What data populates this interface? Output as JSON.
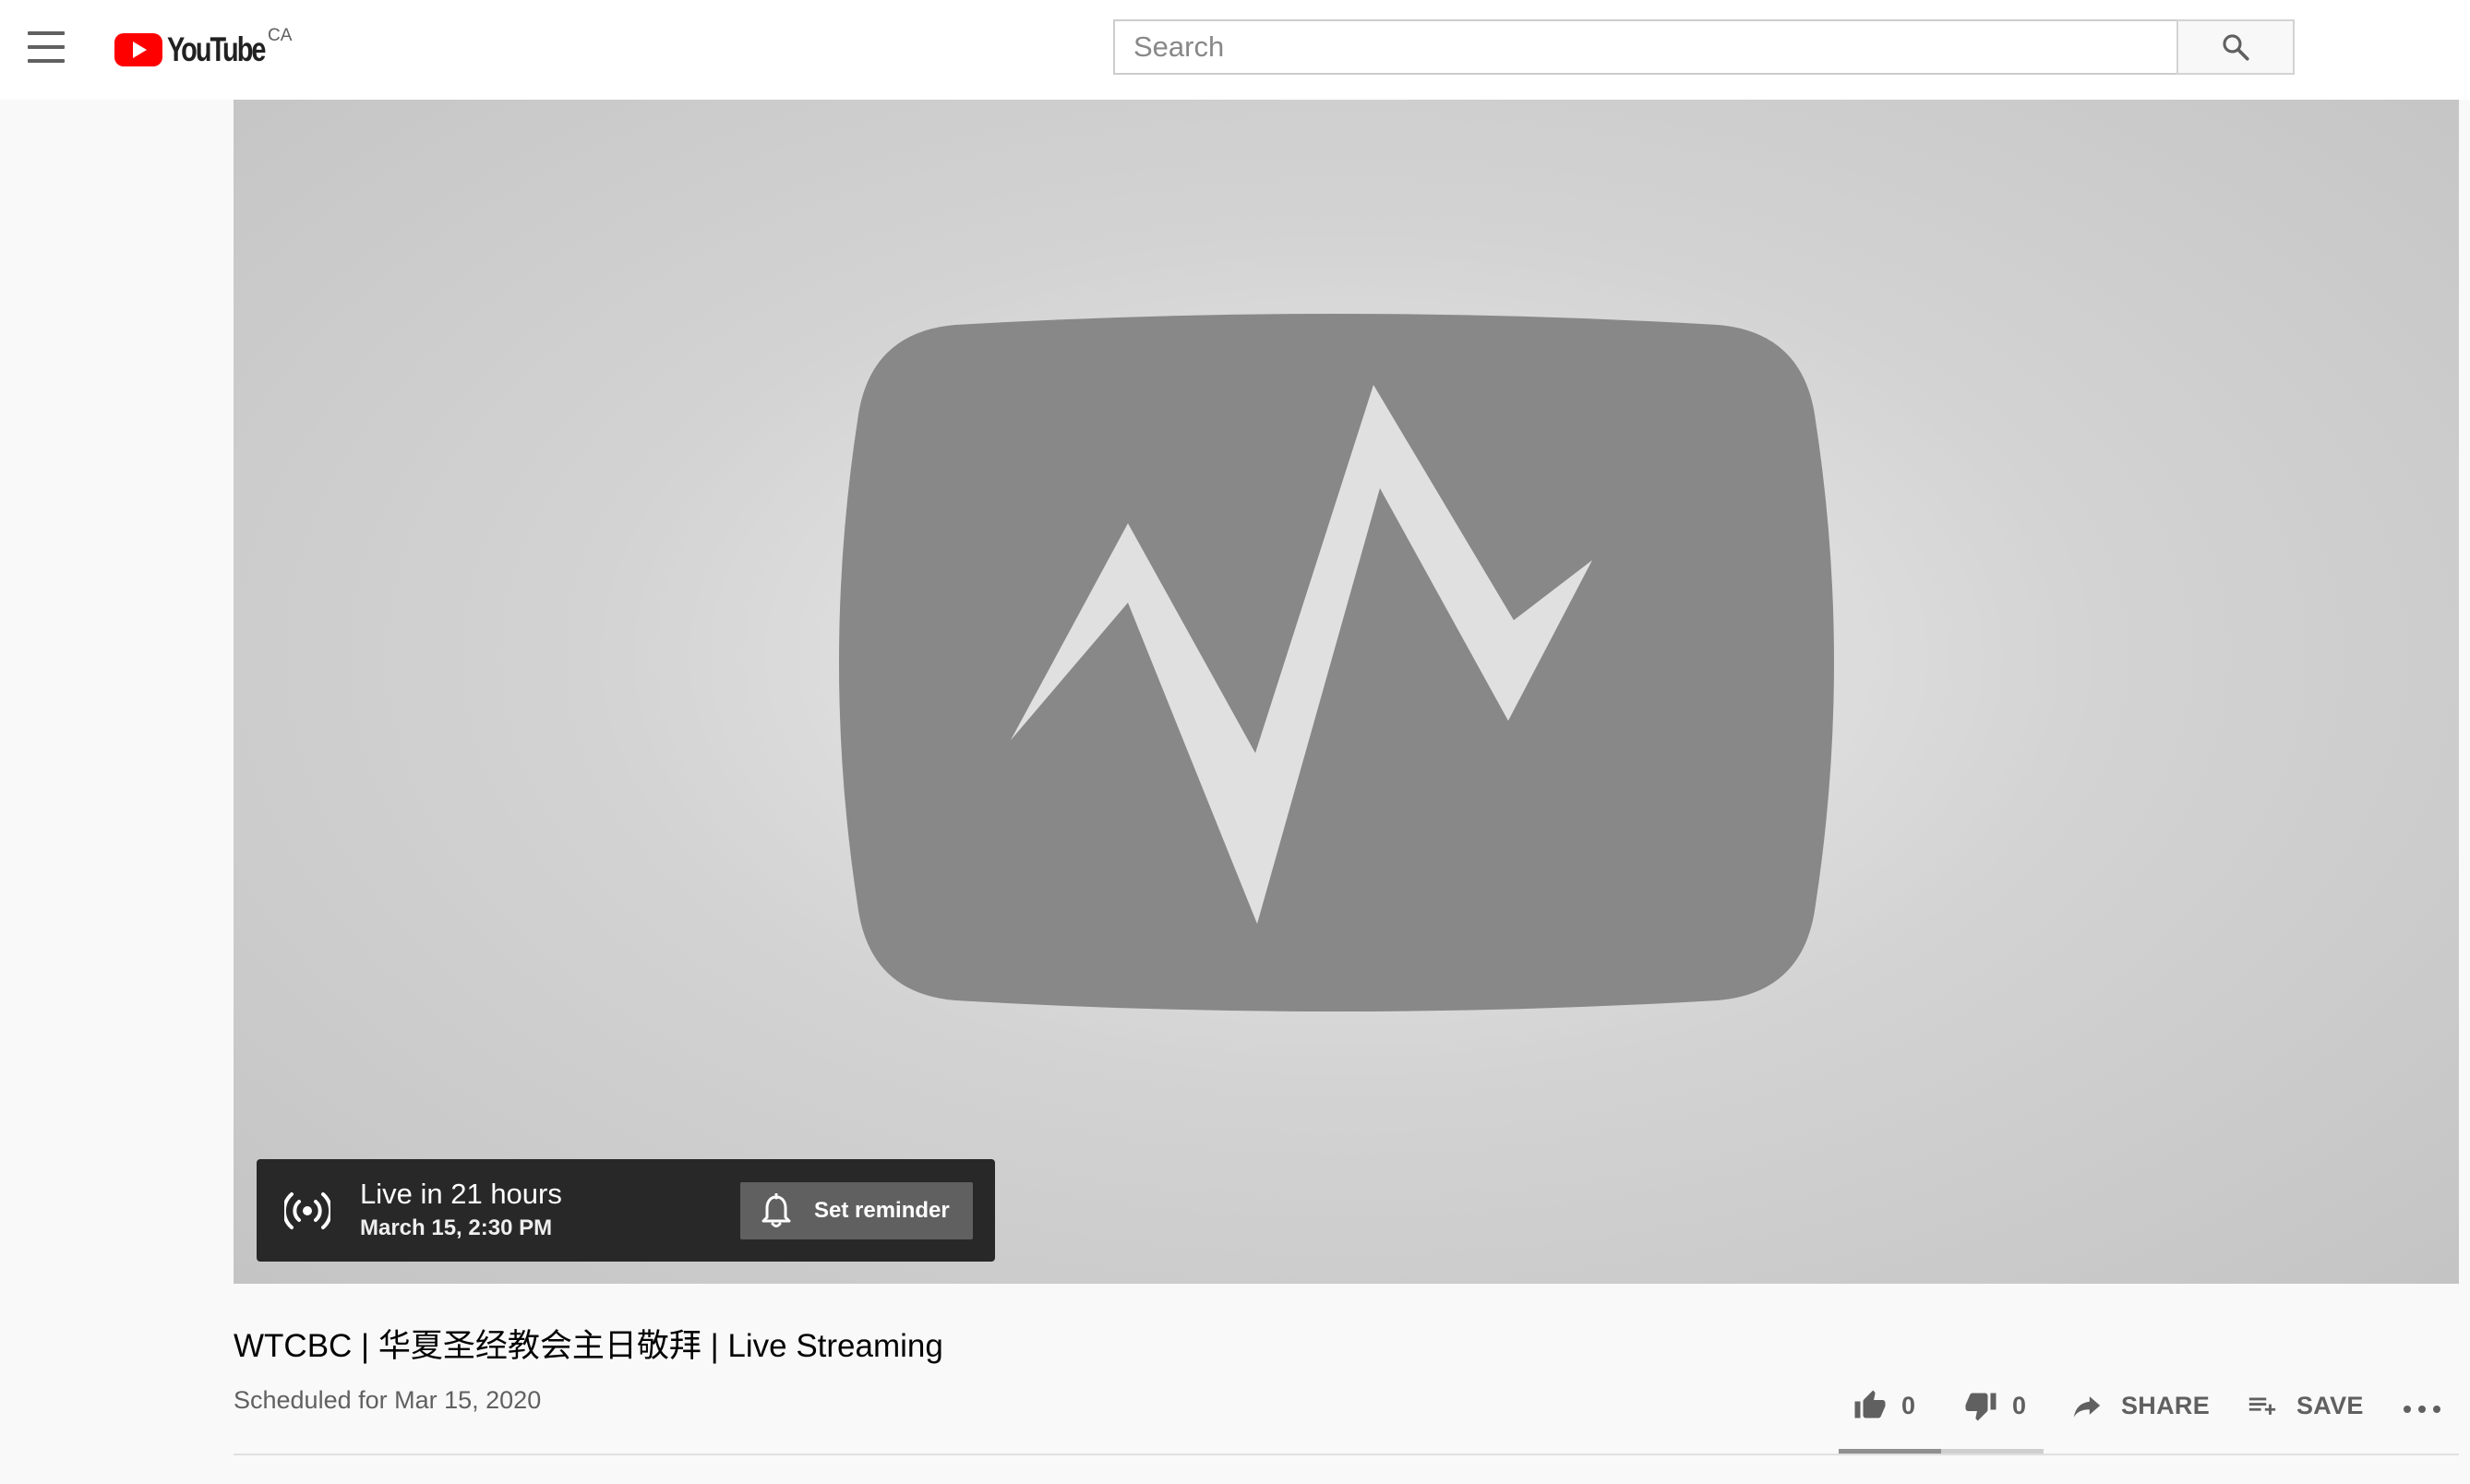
{
  "masthead": {
    "logo_text": "YouTube",
    "country_code": "CA",
    "search_placeholder": "Search"
  },
  "player": {
    "live_title": "Live in 21 hours",
    "live_subtitle": "March 15, 2:30 PM",
    "reminder_label": "Set reminder"
  },
  "video": {
    "title": "WTCBC | 华夏圣经教会主日敬拜 | Live Streaming",
    "date": "Scheduled for Mar 15, 2020"
  },
  "actions": {
    "like_count": "0",
    "dislike_count": "0",
    "share_label": "SHARE",
    "save_label": "SAVE",
    "like_ratio": 0.5
  },
  "colors": {
    "brand_red": "#ff0000",
    "live_card_bg": "#282828",
    "reminder_bg": "#606060",
    "icon_gray": "#606060"
  }
}
